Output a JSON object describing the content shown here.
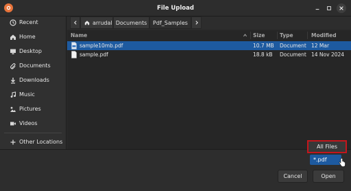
{
  "window": {
    "title": "File Upload"
  },
  "sidebar": {
    "items": [
      {
        "label": "Recent",
        "icon": "clock-icon"
      },
      {
        "label": "Home",
        "icon": "home-icon"
      },
      {
        "label": "Desktop",
        "icon": "desktop-icon"
      },
      {
        "label": "Documents",
        "icon": "paperclip-icon"
      },
      {
        "label": "Downloads",
        "icon": "download-icon"
      },
      {
        "label": "Music",
        "icon": "music-icon"
      },
      {
        "label": "Pictures",
        "icon": "pictures-icon"
      },
      {
        "label": "Videos",
        "icon": "video-icon"
      }
    ],
    "other_locations": "Other Locations"
  },
  "pathbar": {
    "crumbs": [
      "arrudal",
      "Documents",
      "Pdf_Samples"
    ]
  },
  "filelist": {
    "columns": [
      "Name",
      "Size",
      "Type",
      "Modified"
    ],
    "rows": [
      {
        "name": "sample10mb.pdf",
        "size": "10.7 MB",
        "type": "Document",
        "modified": "12 Mar",
        "selected": true
      },
      {
        "name": "sample.pdf",
        "size": "18.8 kB",
        "type": "Document",
        "modified": "14 Nov 2024",
        "selected": false
      }
    ]
  },
  "filter": {
    "selected": "All Files",
    "option": "*.pdf"
  },
  "buttons": {
    "cancel": "Cancel",
    "open": "Open"
  },
  "colors": {
    "selection": "#1d5aa0",
    "highlight_box": "#c4161c",
    "app_icon": "#e8743b"
  }
}
